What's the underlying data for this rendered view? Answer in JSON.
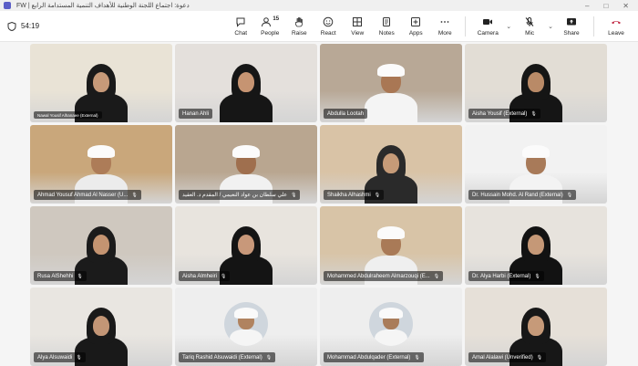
{
  "window": {
    "title": "دعوة: اجتماع اللجنة الوطنية للأهداف التنمية المستدامة الرابع | FW"
  },
  "toolbar": {
    "timer": "54:19",
    "chat": "Chat",
    "people": "People",
    "people_count": "15",
    "raise": "Raise",
    "react": "React",
    "view": "View",
    "notes": "Notes",
    "apps": "Apps",
    "more": "More",
    "camera": "Camera",
    "mic": "Mic",
    "share": "Share",
    "leave": "Leave"
  },
  "participants": [
    {
      "name": "Nawal Yousif Alhanaee (External)",
      "bg": "#e9e3d6",
      "skin": "#c79a79",
      "cloth": "#1a1a1a",
      "type": "f"
    },
    {
      "name": "Hanan Ahli",
      "bg": "#e4e0dc",
      "skin": "#c69472",
      "cloth": "#161616",
      "type": "f"
    },
    {
      "name": "Abdulla Lootah",
      "bg": "#b8a896",
      "skin": "#a97754",
      "cloth": "#f4f4f4",
      "type": "m"
    },
    {
      "name": "Aisha Yousif (External)",
      "bg": "#e2ddd5",
      "skin": "#b98a67",
      "cloth": "#151515",
      "type": "f"
    },
    {
      "name": "Ahmad Yousuf Ahmad Al Nasser (U...",
      "bg": "#c9a77b",
      "skin": "#ad7c58",
      "cloth": "#ececec",
      "type": "m"
    },
    {
      "name": "علي سلطان بن عواد النعيمي / المقدم د. العقيد",
      "bg": "#b9a690",
      "skin": "#9f6f4e",
      "cloth": "#f1f1f1",
      "type": "m"
    },
    {
      "name": "Shaikha Alhashmi",
      "bg": "#d9c3a6",
      "skin": "#c69b78",
      "cloth": "#2a2a2a",
      "type": "f"
    },
    {
      "name": "Dr. Hussain Mohd. Al Rand (External)",
      "bg": "#f2f2f2",
      "skin": "#a87a59",
      "cloth": "#f3f3f3",
      "type": "m"
    },
    {
      "name": "Rusa AlShehhi",
      "bg": "#cfc8bf",
      "skin": "#c49471",
      "cloth": "#1b1b1b",
      "type": "f"
    },
    {
      "name": "Aisha Almheiri",
      "bg": "#e8e4de",
      "skin": "#c8987a",
      "cloth": "#141414",
      "type": "f"
    },
    {
      "name": "Mohammed Abdulraheem Almarzouqi (E...",
      "bg": "#d8c4a7",
      "skin": "#a97a57",
      "cloth": "#efefef",
      "type": "m"
    },
    {
      "name": "Dr. Alya Harbi (External)",
      "bg": "#e7e3dd",
      "skin": "#c59877",
      "cloth": "#121212",
      "type": "f"
    },
    {
      "name": "Alya Alsuwaidi",
      "bg": "#e9e6e1",
      "skin": "#c39676",
      "cloth": "#191919",
      "type": "f"
    },
    {
      "name": "Tariq Rashid Alsuwaidi (External)",
      "bg": "#eeeeee",
      "skin": "#b08360",
      "cloth": "#f5f5f5",
      "type": "avatar"
    },
    {
      "name": "Mohammad Abdulqader (External)",
      "bg": "#eeeeee",
      "skin": "#a97c5a",
      "cloth": "#f5f5f5",
      "type": "avatar"
    },
    {
      "name": "Amal Alalawi (Unverified)",
      "bg": "#e6e0d8",
      "skin": "#c69a79",
      "cloth": "#171717",
      "type": "f"
    }
  ]
}
